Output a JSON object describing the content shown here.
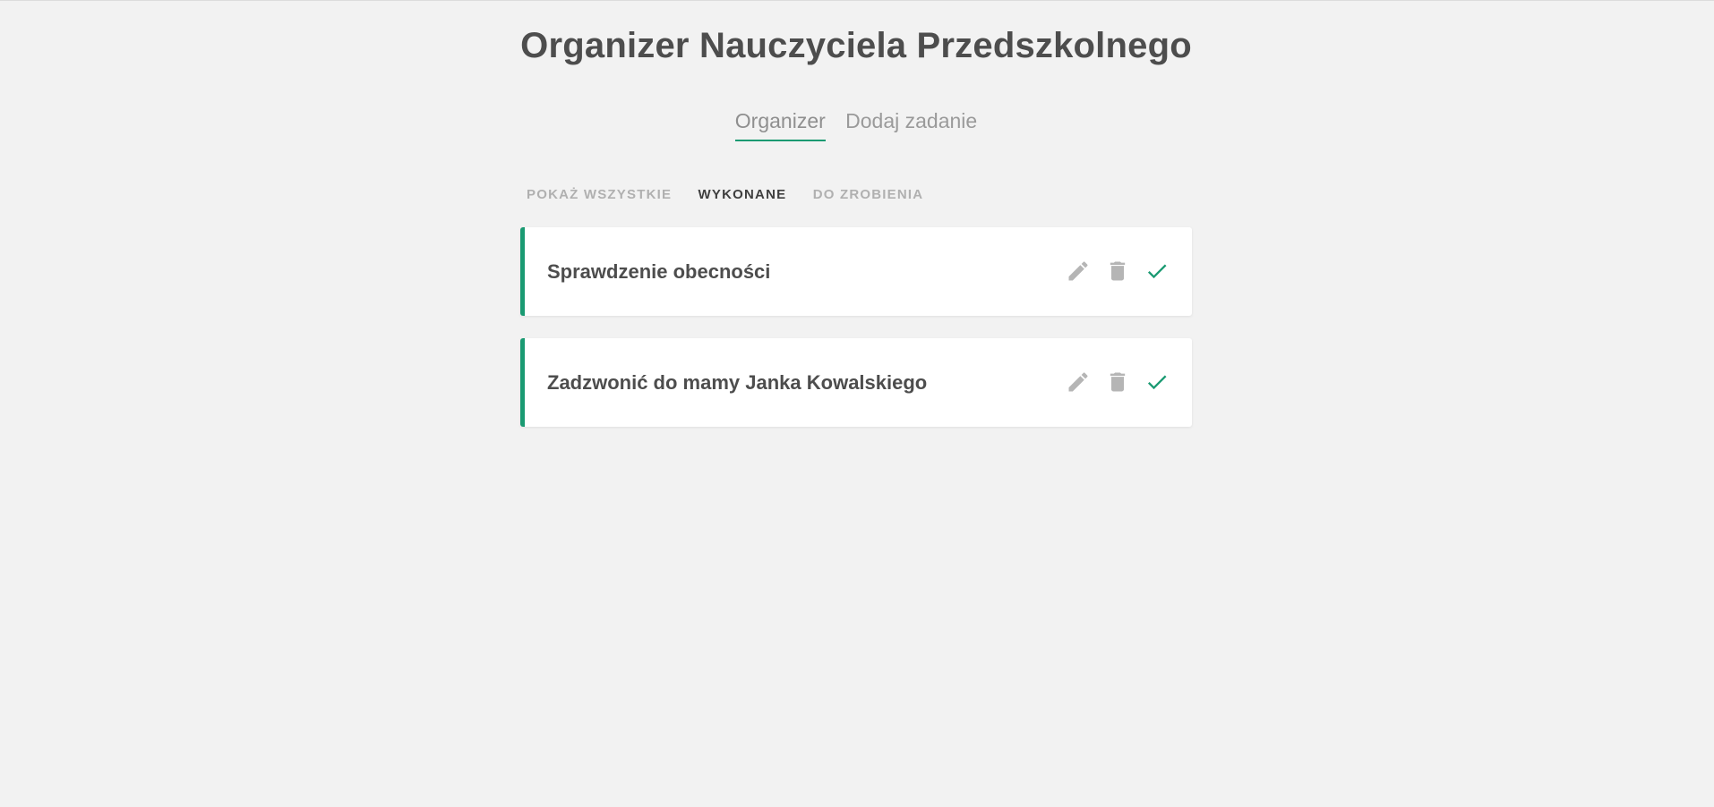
{
  "app": {
    "title": "Organizer Nauczyciela Przedszkolnego"
  },
  "nav": {
    "items": [
      {
        "label": "Organizer",
        "active": true
      },
      {
        "label": "Dodaj zadanie",
        "active": false
      }
    ]
  },
  "filters": {
    "items": [
      {
        "label": "POKAŻ WSZYSTKIE",
        "active": false
      },
      {
        "label": "WYKONANE",
        "active": true
      },
      {
        "label": "DO ZROBIENIA",
        "active": false
      }
    ]
  },
  "tasks": [
    {
      "title": "Sprawdzenie obecności",
      "done": true
    },
    {
      "title": "Zadzwonić do mamy Janka Kowalskiego",
      "done": true
    }
  ],
  "icons": {
    "edit": "pencil-icon",
    "delete": "trash-icon",
    "complete": "check-icon"
  },
  "colors": {
    "accent": "#1a9a72",
    "background": "#f2f2f2",
    "icon_muted": "#b5b5b5",
    "text_primary": "#4d4d4d"
  }
}
